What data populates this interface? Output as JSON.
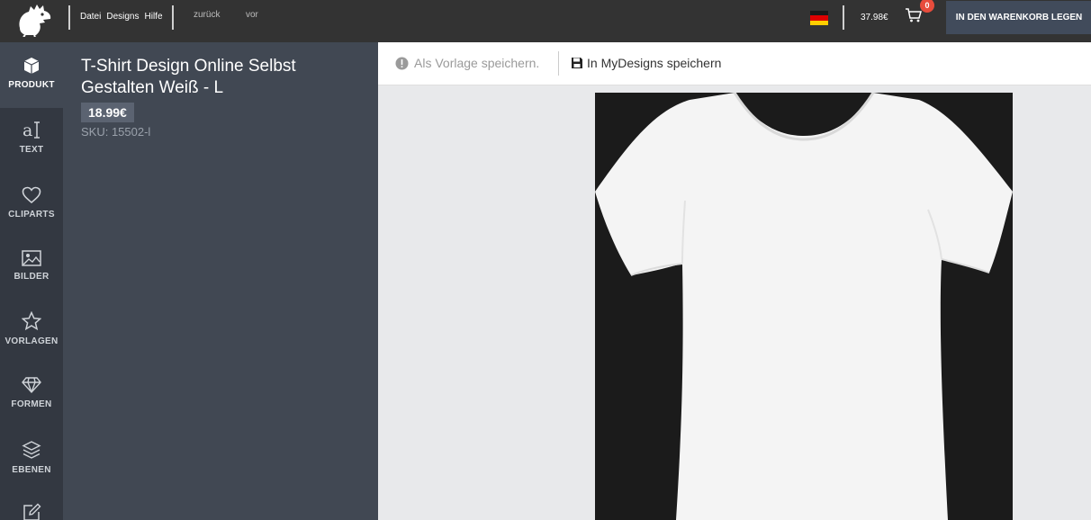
{
  "topbar": {
    "menu": [
      "Datei",
      "Designs",
      "Hilfe"
    ],
    "undo_label": "zurück",
    "redo_label": "vor",
    "total": "37.98€",
    "cart_count": "0",
    "cart_button_label": "IN DEN WARENKORB LEGEN",
    "flag_colors": [
      "#1a1a1a",
      "#dd0000",
      "#ffce00"
    ]
  },
  "sidebar": {
    "items": [
      {
        "label": "PRODUKT",
        "icon": "box-icon"
      },
      {
        "label": "TEXT",
        "icon": "text-icon"
      },
      {
        "label": "CLIPARTS",
        "icon": "heart-icon"
      },
      {
        "label": "BILDER",
        "icon": "image-icon"
      },
      {
        "label": "VORLAGEN",
        "icon": "star-icon"
      },
      {
        "label": "FORMEN",
        "icon": "diamond-icon"
      },
      {
        "label": "EBENEN",
        "icon": "layers-icon"
      },
      {
        "label": "",
        "icon": "edit-icon"
      }
    ]
  },
  "product": {
    "title": "T-Shirt Design Online Selbst Gestalten Weiß - L",
    "price": "18.99€",
    "sku": "SKU: 15502-l"
  },
  "toolbar": {
    "save_template_label": "Als Vorlage speichern.",
    "save_mydesigns_label": "In MyDesigns speichern"
  },
  "colors": {
    "topbar": "#333333",
    "rail": "#333841",
    "panel": "#414853",
    "cart_badge": "#e74c3c",
    "shirt_background": "#1b1b1b"
  }
}
